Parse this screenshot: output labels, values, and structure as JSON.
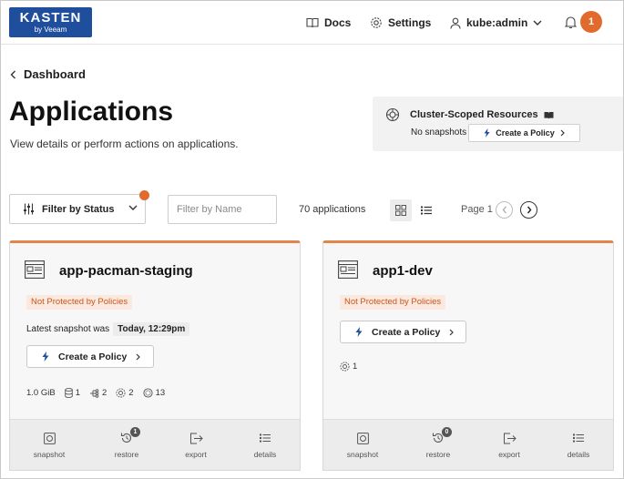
{
  "header": {
    "logo_line1": "KASTEN",
    "logo_line2": "by Veeam",
    "docs_label": "Docs",
    "settings_label": "Settings",
    "user_label": "kube:admin",
    "notification_count": "1"
  },
  "breadcrumb": {
    "label": "Dashboard"
  },
  "page": {
    "title": "Applications",
    "subtitle": "View details or perform actions on applications."
  },
  "cluster": {
    "title": "Cluster-Scoped Resources",
    "status": "No snapshots",
    "action_label": "Create a Policy"
  },
  "toolbar": {
    "filter_status_label": "Filter by Status",
    "filter_name_placeholder": "Filter by Name",
    "app_count": "70 applications",
    "page_label": "Page 1"
  },
  "apps": [
    {
      "name": "app-pacman-staging",
      "protection": "Not Protected by Policies",
      "snapshot_prefix": "Latest snapshot was",
      "snapshot_time": "Today, 12:29pm",
      "action_label": "Create a Policy",
      "stats": {
        "size": "1.0 GiB",
        "volumes": "1",
        "workloads": "2",
        "services": "2",
        "resources": "13"
      },
      "footer": {
        "snapshot": "snapshot",
        "restore": "restore",
        "restore_count": "1",
        "export": "export",
        "details": "details"
      }
    },
    {
      "name": "app1-dev",
      "protection": "Not Protected by Policies",
      "action_label": "Create a Policy",
      "stats": {
        "services": "1"
      },
      "footer": {
        "snapshot": "snapshot",
        "restore": "restore",
        "restore_count": "0",
        "export": "export",
        "details": "details"
      }
    }
  ],
  "colors": {
    "brand": "#1f4e9c",
    "accent": "#e06b2d",
    "warning_text": "#c9561a",
    "warning_bg": "#fbe9e0"
  }
}
